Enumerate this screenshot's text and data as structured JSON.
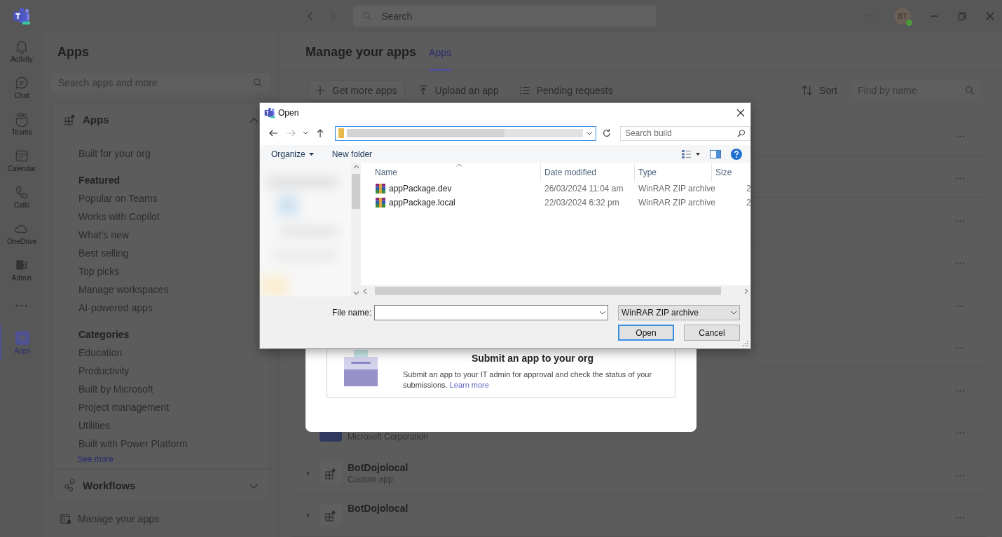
{
  "title_bar": {
    "search_placeholder": "Search",
    "avatar_initials": "BT"
  },
  "app_bar": [
    {
      "kind": "app",
      "label": "Activity",
      "selected": false
    },
    {
      "kind": "app",
      "label": "Chat",
      "selected": false
    },
    {
      "kind": "app",
      "label": "Teams",
      "selected": false
    },
    {
      "kind": "app",
      "label": "Calendar",
      "selected": false
    },
    {
      "kind": "app",
      "label": "Calls",
      "selected": false
    },
    {
      "kind": "app",
      "label": "OneDrive",
      "selected": false
    },
    {
      "kind": "app",
      "label": "Admin",
      "selected": false
    },
    {
      "kind": "more",
      "selected": false
    },
    {
      "kind": "app",
      "label": "Apps",
      "selected": true
    }
  ],
  "sidebar": {
    "title": "Apps",
    "search_placeholder": "Search apps and more",
    "sections": [
      {
        "title": "Apps",
        "expanded": true,
        "items": [
          {
            "kind": "link",
            "label": "Built for your org"
          },
          {
            "kind": "heading",
            "label": "Featured"
          },
          {
            "kind": "link",
            "label": "Popular on Teams"
          },
          {
            "kind": "link",
            "label": "Works with Copilot"
          },
          {
            "kind": "link",
            "label": "What's new"
          },
          {
            "kind": "link",
            "label": "Best selling"
          },
          {
            "kind": "link",
            "label": "Top picks"
          },
          {
            "kind": "link",
            "label": "Manage workspaces"
          },
          {
            "kind": "link",
            "label": "AI-powered apps"
          },
          {
            "kind": "heading",
            "label": "Categories"
          },
          {
            "kind": "link",
            "label": "Education"
          },
          {
            "kind": "link",
            "label": "Productivity"
          },
          {
            "kind": "link",
            "label": "Built by Microsoft"
          },
          {
            "kind": "link",
            "label": "Project management"
          },
          {
            "kind": "link",
            "label": "Utilities"
          },
          {
            "kind": "link",
            "label": "Built with Power Platform"
          },
          {
            "kind": "more",
            "label": "See more"
          }
        ]
      },
      {
        "title": "Workflows",
        "expanded": false
      }
    ],
    "footer": "Manage your apps"
  },
  "main": {
    "title": "Manage your apps",
    "tabs": [
      {
        "label": "Apps",
        "selected": true
      }
    ],
    "toolbar": [
      {
        "kind": "outlined",
        "label": "Get more apps"
      },
      {
        "kind": "plain",
        "label": "Upload an app"
      },
      {
        "kind": "plain",
        "label": "Pending requests"
      }
    ],
    "sort": "Sort",
    "find_placeholder": "Find by name",
    "rows": [
      {},
      {},
      {},
      {},
      {},
      {},
      {},
      {
        "kind": "brand",
        "subtitle": "Microsoft Corporation"
      },
      {
        "kind": "generic",
        "expanded": false,
        "name": "BotDojolocal",
        "subtitle": "Custom app"
      },
      {
        "kind": "generic",
        "expanded": false,
        "name": "BotDojolocal"
      }
    ]
  },
  "modal": {
    "card_title": "Submit an app to your org",
    "card_text": "Submit an app to your IT admin for approval and check the status of your submissions.",
    "link": "Learn more"
  },
  "dialog": {
    "title": "Open",
    "search_placeholder": "Search build",
    "toolbar": [
      {
        "kind": "menu",
        "label": "Organize"
      },
      {
        "kind": "button",
        "label": "New folder"
      }
    ],
    "columns": [
      {
        "label": "Name",
        "sorted": true
      },
      {
        "label": "Date modified",
        "sorted": false
      },
      {
        "label": "Type",
        "sorted": false
      },
      {
        "label": "Size",
        "sorted": false
      }
    ],
    "files": [
      {
        "name": "appPackage.dev",
        "date": "26/03/2024 11:04 am",
        "type": "WinRAR ZIP archive",
        "size": "2"
      },
      {
        "name": "appPackage.local",
        "date": "22/03/2024 6:32 pm",
        "type": "WinRAR ZIP archive",
        "size": "2"
      }
    ],
    "file_name_label": "File name:",
    "filter": "WinRAR ZIP archive",
    "buttons": [
      {
        "label": "Open",
        "default": true
      },
      {
        "label": "Cancel",
        "default": false
      }
    ]
  }
}
